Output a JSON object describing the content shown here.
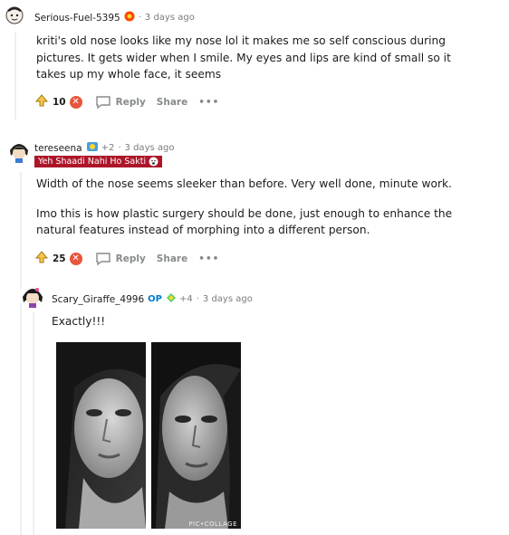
{
  "comments": [
    {
      "author": "Serious-Fuel-5395",
      "time": "3 days ago",
      "body": [
        "kriti's old nose looks like my nose lol it makes me so self conscious during pictures. It gets wider when I smile. My eyes and lips are kind of small so it takes up my whole face, it seems"
      ],
      "score": "10",
      "reply_label": "Reply",
      "share_label": "Share",
      "more_label": "•••"
    },
    {
      "author": "tereseena",
      "award_count": "+2",
      "time": "3 days ago",
      "flair": "Yeh Shaadi Nahi Ho Sakti",
      "body": [
        "Width of the nose seems sleeker than before. Very well done, minute work.",
        "Imo this is how plastic surgery should be done, just enough to enhance the natural features instead of morphing into a different person."
      ],
      "score": "25",
      "reply_label": "Reply",
      "share_label": "Share",
      "more_label": "•••"
    },
    {
      "author": "Scary_Giraffe_4996",
      "op_label": "OP",
      "award_count": "+4",
      "time": "3 days ago",
      "body": [
        "Exactly!!!"
      ],
      "image_watermark": "PIC•COLLAGE"
    }
  ],
  "colors": {
    "downvote": "#e8553b",
    "flair_bg": "#ad1529",
    "op": "#0079d3",
    "meta": "#7c7c7c"
  },
  "icons": [
    "upvote-icon",
    "downvote-icon",
    "comment-bubble-icon",
    "more-icon",
    "award-icon"
  ]
}
